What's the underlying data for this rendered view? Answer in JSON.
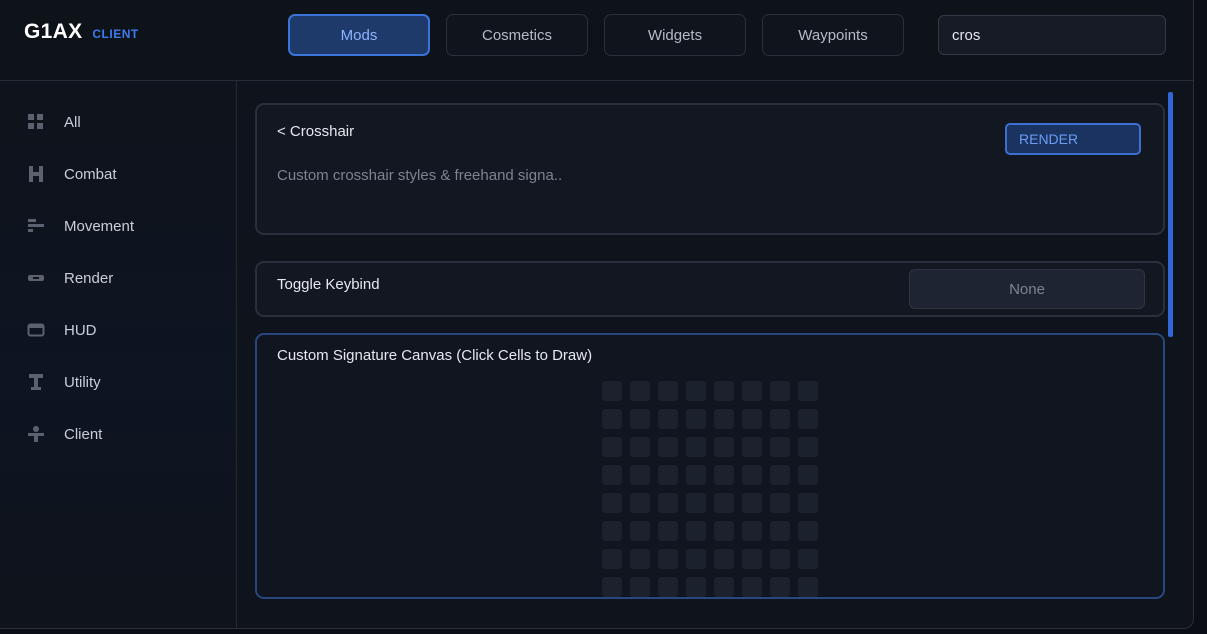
{
  "brand": {
    "name": "G1AX",
    "tag": "CLIENT"
  },
  "tabs": [
    {
      "label": "Mods",
      "active": true
    },
    {
      "label": "Cosmetics",
      "active": false
    },
    {
      "label": "Widgets",
      "active": false
    },
    {
      "label": "Waypoints",
      "active": false
    }
  ],
  "search": {
    "value": "cros"
  },
  "sidebar": {
    "items": [
      {
        "label": "All",
        "icon": "grid-icon"
      },
      {
        "label": "Combat",
        "icon": "combat-icon"
      },
      {
        "label": "Movement",
        "icon": "movement-icon"
      },
      {
        "label": "Render",
        "icon": "render-icon"
      },
      {
        "label": "HUD",
        "icon": "hud-icon"
      },
      {
        "label": "Utility",
        "icon": "utility-icon"
      },
      {
        "label": "Client",
        "icon": "client-icon"
      }
    ]
  },
  "mod": {
    "back_label": "<  Crosshair",
    "description": "Custom crosshair styles & freehand signa..",
    "category_badge": "RENDER"
  },
  "keybind": {
    "label": "Toggle Keybind",
    "value": "None"
  },
  "canvas": {
    "label": "Custom Signature Canvas (Click Cells to Draw)",
    "columns": 8
  },
  "colors": {
    "accent": "#3b74d9",
    "background": "#0f131b",
    "cell": "#1b212d"
  }
}
